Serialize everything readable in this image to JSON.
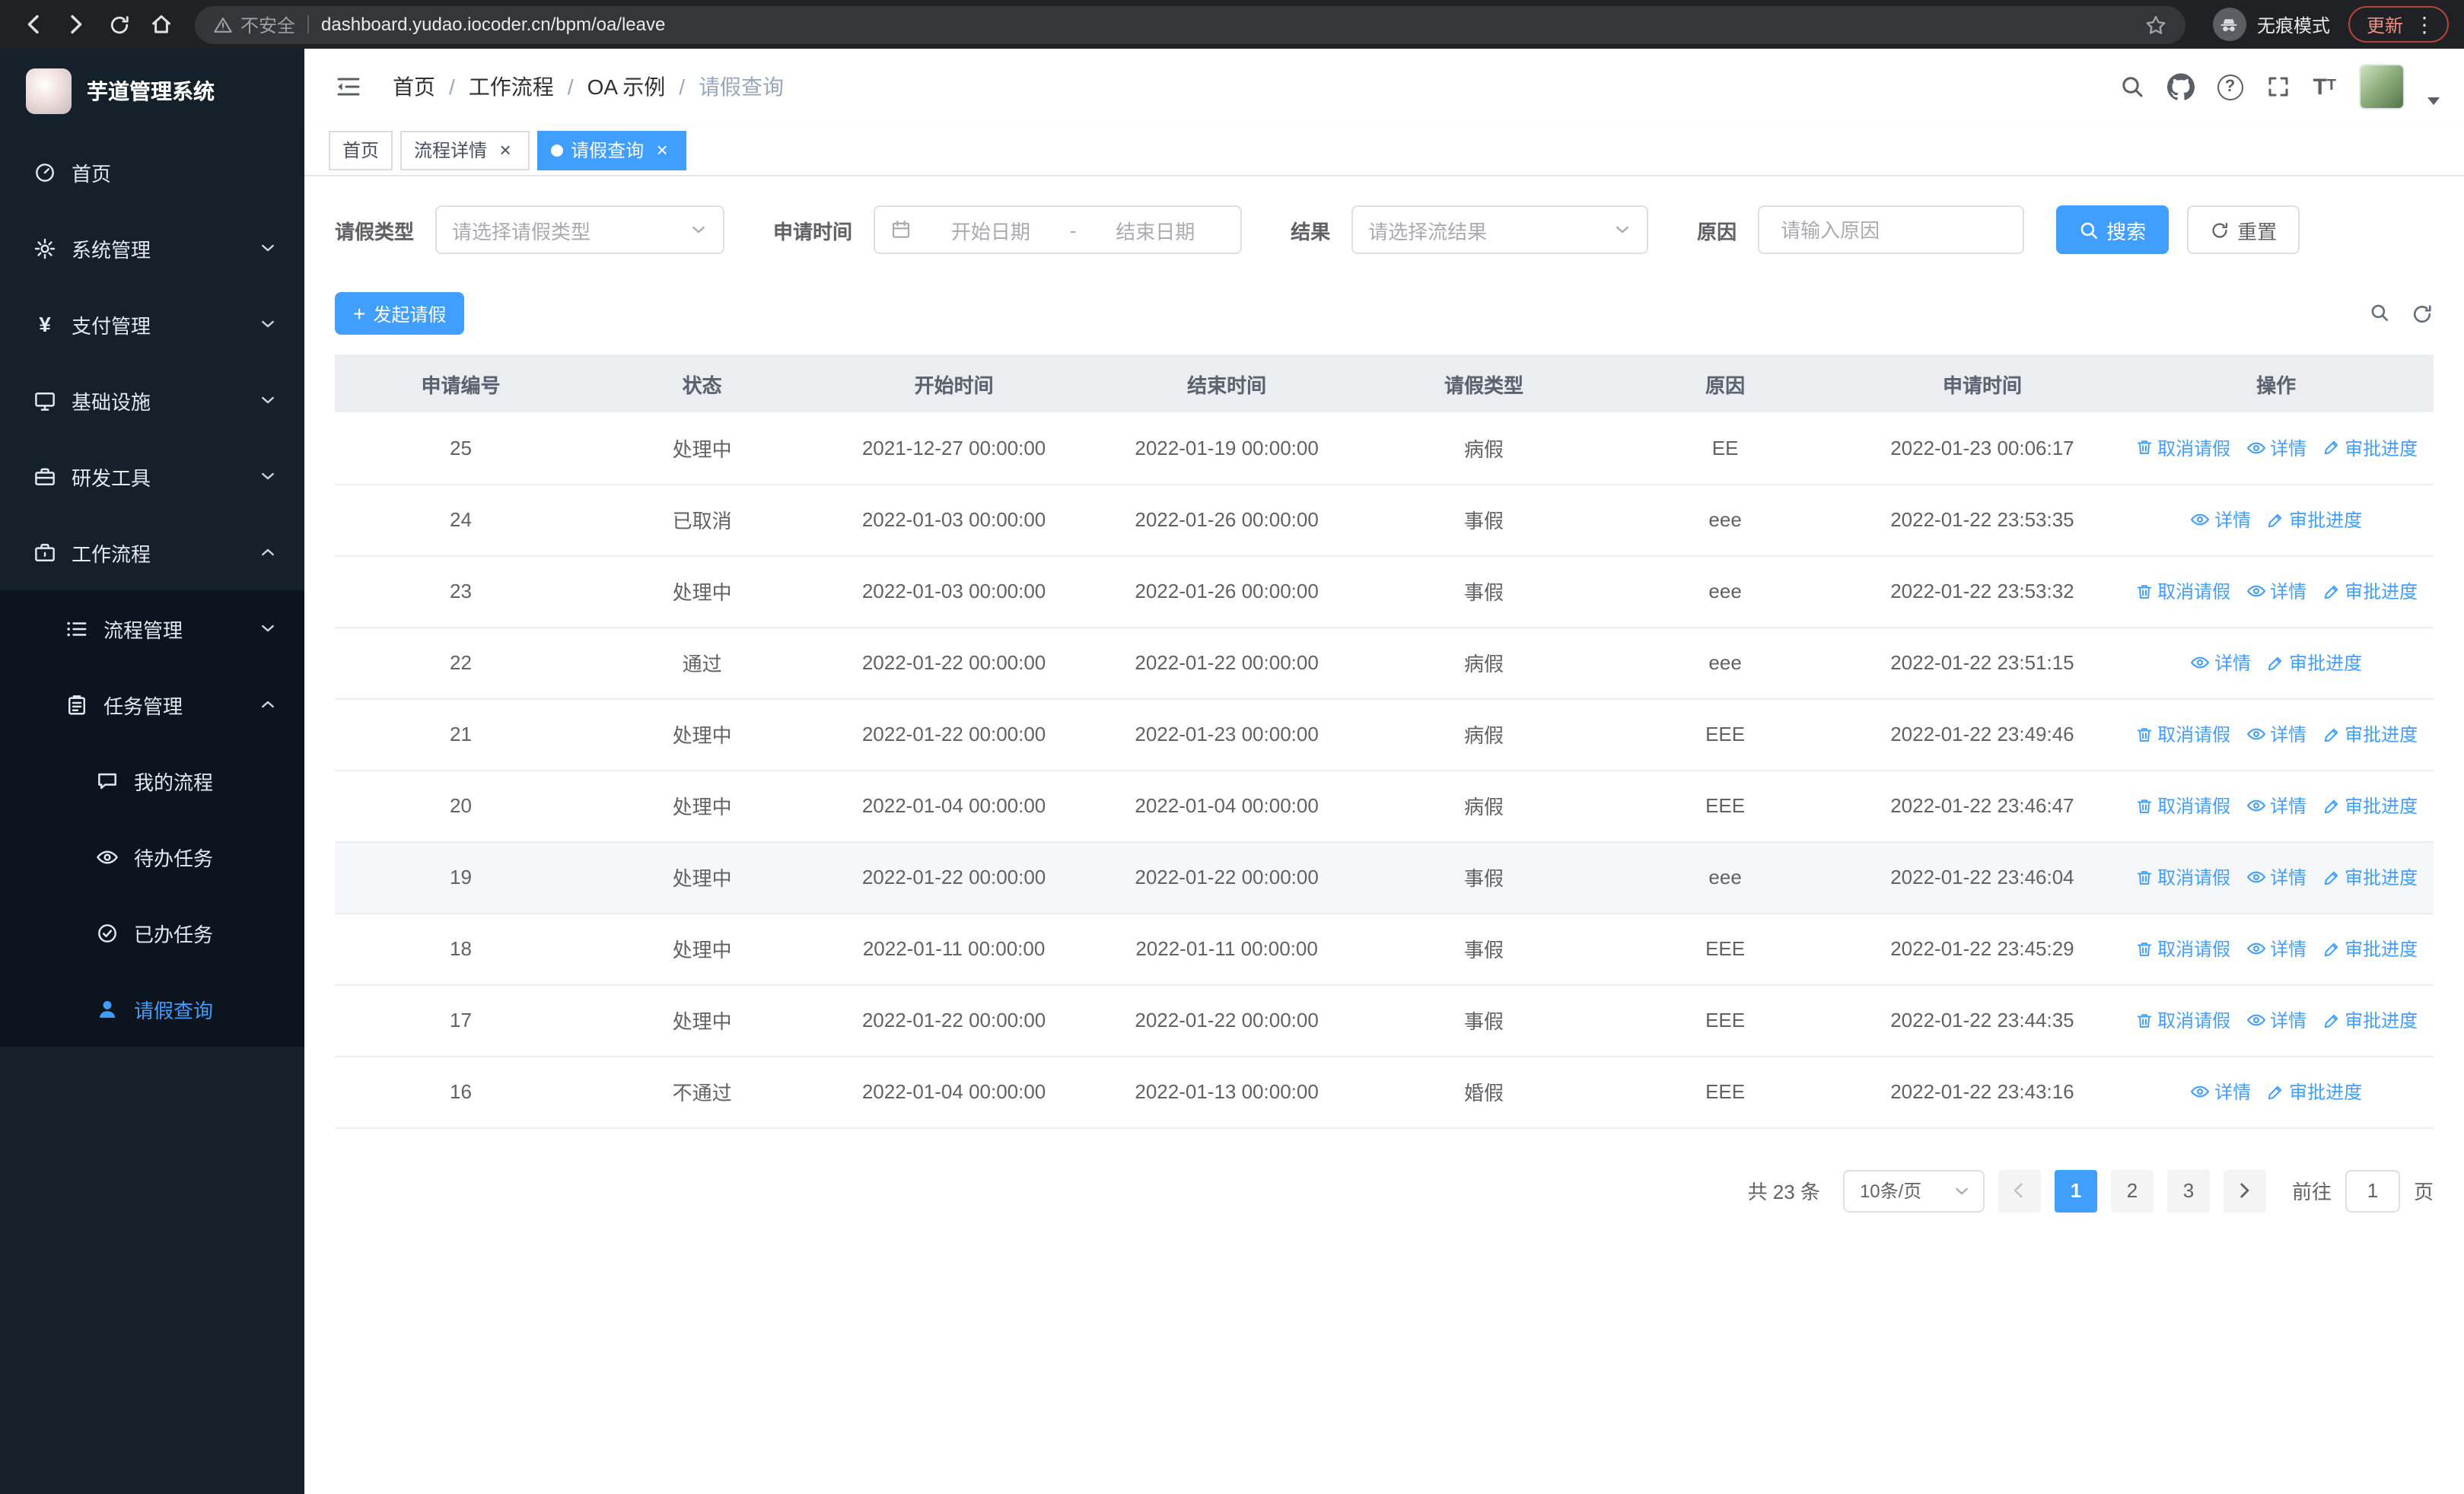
{
  "colors": {
    "primary": "#409eff",
    "tab_active": "#409eff",
    "sidebar_bg": "#14212b",
    "table_header_bg": "#ebedf0"
  },
  "browser": {
    "security_label": "不安全",
    "url": "dashboard.yudao.iocoder.cn/bpm/oa/leave",
    "incognito_label": "无痕模式",
    "update_label": "更新"
  },
  "sidebar": {
    "logo_title": "芋道管理系统",
    "items": [
      {
        "key": "home",
        "icon": "dashboard",
        "label": "首页",
        "depth": 0
      },
      {
        "key": "system-management",
        "icon": "gear",
        "label": "系统管理",
        "depth": 0,
        "chevron": "down"
      },
      {
        "key": "payment-management",
        "icon": "yen",
        "label": "支付管理",
        "depth": 0,
        "chevron": "down"
      },
      {
        "key": "infrastructure",
        "icon": "monitor",
        "label": "基础设施",
        "depth": 0,
        "chevron": "down"
      },
      {
        "key": "dev-tools",
        "icon": "toolbox",
        "label": "研发工具",
        "depth": 0,
        "chevron": "down"
      },
      {
        "key": "workflow",
        "icon": "briefcase",
        "label": "工作流程",
        "depth": 0,
        "chevron": "up"
      },
      {
        "key": "process-management",
        "icon": "list",
        "label": "流程管理",
        "depth": 1,
        "chevron": "down"
      },
      {
        "key": "task-management",
        "icon": "clipboard",
        "label": "任务管理",
        "depth": 1,
        "chevron": "up"
      },
      {
        "key": "my-process",
        "icon": "chat",
        "label": "我的流程",
        "depth": 2
      },
      {
        "key": "todo-tasks",
        "icon": "eye",
        "label": "待办任务",
        "depth": 2
      },
      {
        "key": "done-tasks",
        "icon": "check-circle",
        "label": "已办任务",
        "depth": 2
      },
      {
        "key": "leave-query",
        "icon": "user",
        "label": "请假查询",
        "depth": 2,
        "active": true
      }
    ]
  },
  "header": {
    "breadcrumb": [
      "首页",
      "工作流程",
      "OA 示例",
      "请假查询"
    ]
  },
  "tabs": [
    {
      "key": "home",
      "label": "首页"
    },
    {
      "key": "process-detail",
      "label": "流程详情",
      "closable": true
    },
    {
      "key": "leave-query",
      "label": "请假查询",
      "closable": true,
      "active": true
    }
  ],
  "filters": {
    "leave_type": {
      "label": "请假类型",
      "placeholder": "请选择请假类型"
    },
    "apply_time": {
      "label": "申请时间",
      "start_placeholder": "开始日期",
      "separator": "-",
      "end_placeholder": "结束日期"
    },
    "result": {
      "label": "结果",
      "placeholder": "请选择流结果"
    },
    "reason": {
      "label": "原因",
      "placeholder": "请输入原因"
    },
    "search_label": "搜索",
    "reset_label": "重置"
  },
  "toolbar": {
    "create_label": "发起请假"
  },
  "table": {
    "columns": [
      "申请编号",
      "状态",
      "开始时间",
      "结束时间",
      "请假类型",
      "原因",
      "申请时间",
      "操作"
    ],
    "action_labels": {
      "cancel": "取消请假",
      "detail": "详情",
      "progress": "审批进度"
    },
    "rows": [
      {
        "id": "25",
        "status": "处理中",
        "start": "2021-12-27 00:00:00",
        "end": "2022-01-19 00:00:00",
        "type": "病假",
        "reason": "EE",
        "applied": "2022-01-23 00:06:17",
        "cancellable": true
      },
      {
        "id": "24",
        "status": "已取消",
        "start": "2022-01-03 00:00:00",
        "end": "2022-01-26 00:00:00",
        "type": "事假",
        "reason": "eee",
        "applied": "2022-01-22 23:53:35",
        "cancellable": false
      },
      {
        "id": "23",
        "status": "处理中",
        "start": "2022-01-03 00:00:00",
        "end": "2022-01-26 00:00:00",
        "type": "事假",
        "reason": "eee",
        "applied": "2022-01-22 23:53:32",
        "cancellable": true
      },
      {
        "id": "22",
        "status": "通过",
        "start": "2022-01-22 00:00:00",
        "end": "2022-01-22 00:00:00",
        "type": "病假",
        "reason": "eee",
        "applied": "2022-01-22 23:51:15",
        "cancellable": false
      },
      {
        "id": "21",
        "status": "处理中",
        "start": "2022-01-22 00:00:00",
        "end": "2022-01-23 00:00:00",
        "type": "病假",
        "reason": "EEE",
        "applied": "2022-01-22 23:49:46",
        "cancellable": true
      },
      {
        "id": "20",
        "status": "处理中",
        "start": "2022-01-04 00:00:00",
        "end": "2022-01-04 00:00:00",
        "type": "病假",
        "reason": "EEE",
        "applied": "2022-01-22 23:46:47",
        "cancellable": true
      },
      {
        "id": "19",
        "status": "处理中",
        "start": "2022-01-22 00:00:00",
        "end": "2022-01-22 00:00:00",
        "type": "事假",
        "reason": "eee",
        "applied": "2022-01-22 23:46:04",
        "cancellable": true,
        "highlighted": true
      },
      {
        "id": "18",
        "status": "处理中",
        "start": "2022-01-11 00:00:00",
        "end": "2022-01-11 00:00:00",
        "type": "事假",
        "reason": "EEE",
        "applied": "2022-01-22 23:45:29",
        "cancellable": true
      },
      {
        "id": "17",
        "status": "处理中",
        "start": "2022-01-22 00:00:00",
        "end": "2022-01-22 00:00:00",
        "type": "事假",
        "reason": "EEE",
        "applied": "2022-01-22 23:44:35",
        "cancellable": true
      },
      {
        "id": "16",
        "status": "不通过",
        "start": "2022-01-04 00:00:00",
        "end": "2022-01-13 00:00:00",
        "type": "婚假",
        "reason": "EEE",
        "applied": "2022-01-22 23:43:16",
        "cancellable": false
      }
    ]
  },
  "pagination": {
    "total_label": "共 23 条",
    "page_size": "10条/页",
    "pages": [
      "1",
      "2",
      "3"
    ],
    "active_page": "1",
    "goto_label": "前往",
    "goto_value": "1",
    "page_unit": "页"
  }
}
